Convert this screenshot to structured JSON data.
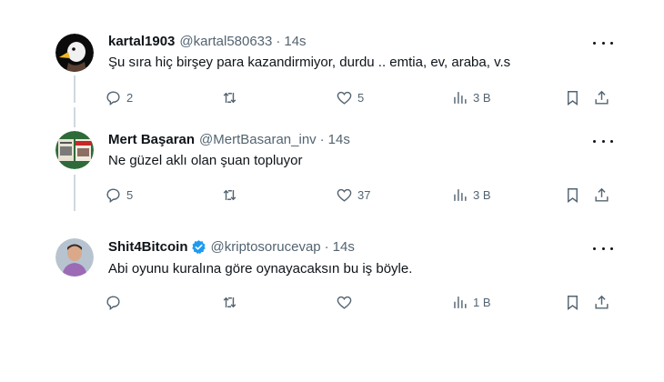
{
  "tweets": [
    {
      "name": "kartal1903",
      "handle": "@kartal580633",
      "dot": "·",
      "time": "14s",
      "text": "Şu sıra hiç birşey para kazandirmiyor, durdu .. emtia, ev, araba, v.s",
      "replies": "2",
      "retweets": "",
      "likes": "5",
      "views": "3 B",
      "avatar": "eagle",
      "verified": false
    },
    {
      "name": "Mert Başaran",
      "handle": "@MertBasaran_inv",
      "dot": "·",
      "time": "14s",
      "text": "Ne güzel aklı olan şuan topluyor",
      "replies": "5",
      "retweets": "",
      "likes": "37",
      "views": "3 B",
      "avatar": "newspaper",
      "verified": false
    },
    {
      "name": "Shit4Bitcoin",
      "handle": "@kriptosorucevap",
      "dot": "·",
      "time": "14s",
      "text": "Abi oyunu kuralına göre oynayacaksın bu iş böyle.",
      "replies": "",
      "retweets": "",
      "likes": "",
      "views": "1 B",
      "avatar": "person",
      "verified": true
    }
  ],
  "colors": {
    "text": "#0f1419",
    "secondary": "#536471",
    "thread": "#cfd9de",
    "verified": "#1d9bf0"
  },
  "icons": [
    "reply-icon",
    "retweet-icon",
    "like-icon",
    "views-icon",
    "bookmark-icon",
    "share-icon",
    "more-icon",
    "verified-badge-icon"
  ]
}
